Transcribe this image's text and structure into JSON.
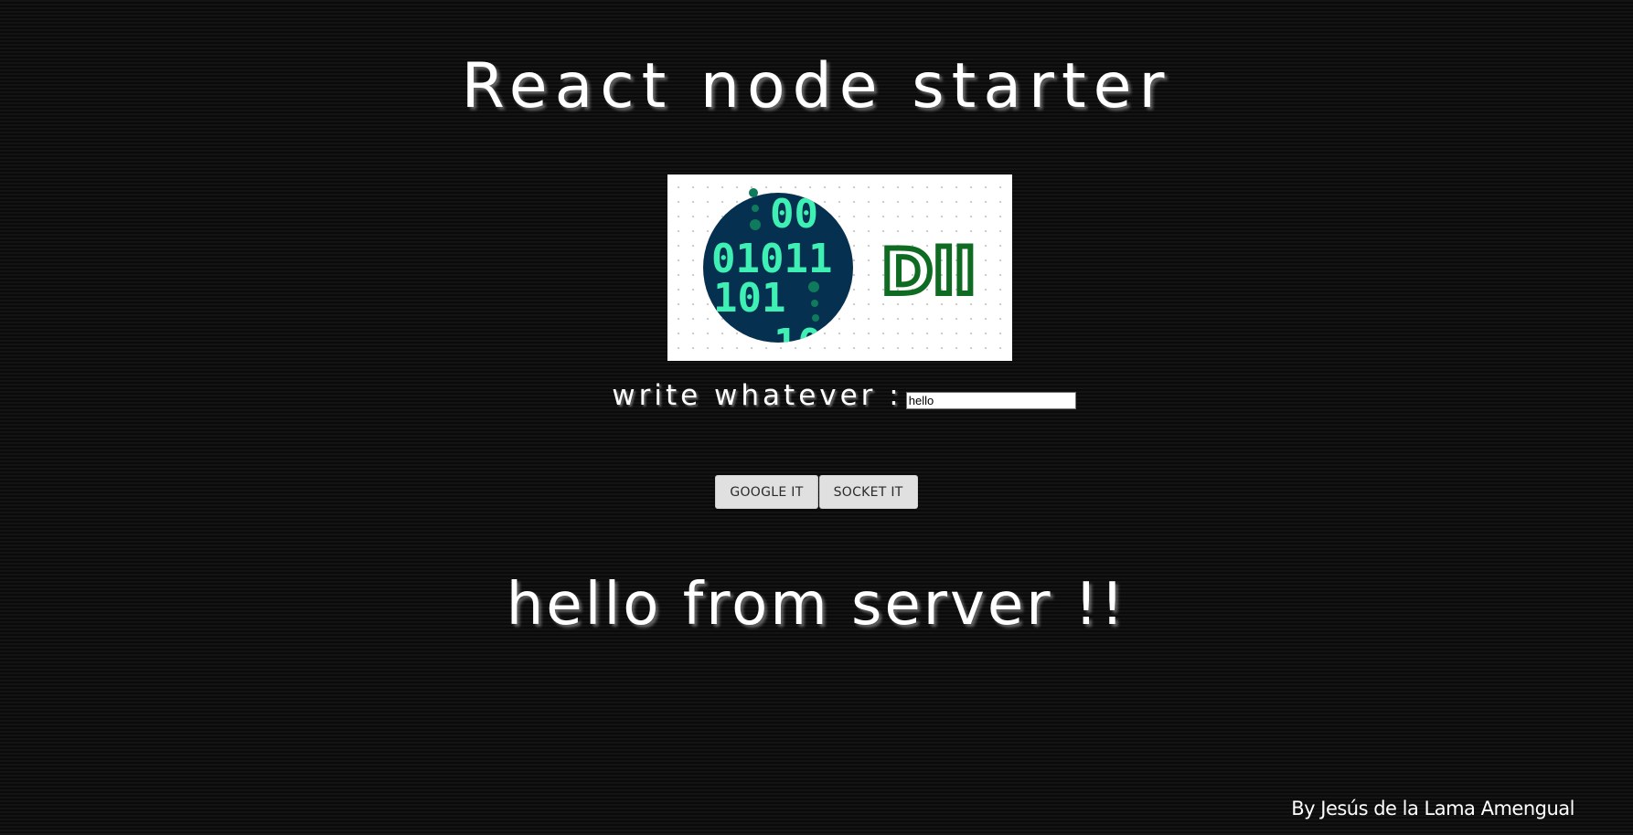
{
  "header": {
    "title": "React node starter"
  },
  "logo": {
    "name": "dll-logo",
    "brand_text": "Dll",
    "binary_rows": [
      "00",
      "01011",
      "101",
      "10"
    ],
    "colors": {
      "circle": "#06304f",
      "digits": "#3ef0b4",
      "dots": "#0f7a5c",
      "brand": "#0f6b21"
    }
  },
  "form": {
    "label": "write whatever :",
    "input_value": "hello",
    "buttons": {
      "google_label": "GOOGLE IT",
      "socket_label": "SOCKET IT"
    }
  },
  "response": {
    "message": "hello from server !!"
  },
  "footer": {
    "credit": "By Jesús de la Lama Amengual"
  },
  "theme": {
    "background": "#0e0e0e",
    "text": "#ffffff",
    "button_bg": "#e0e0e0"
  }
}
